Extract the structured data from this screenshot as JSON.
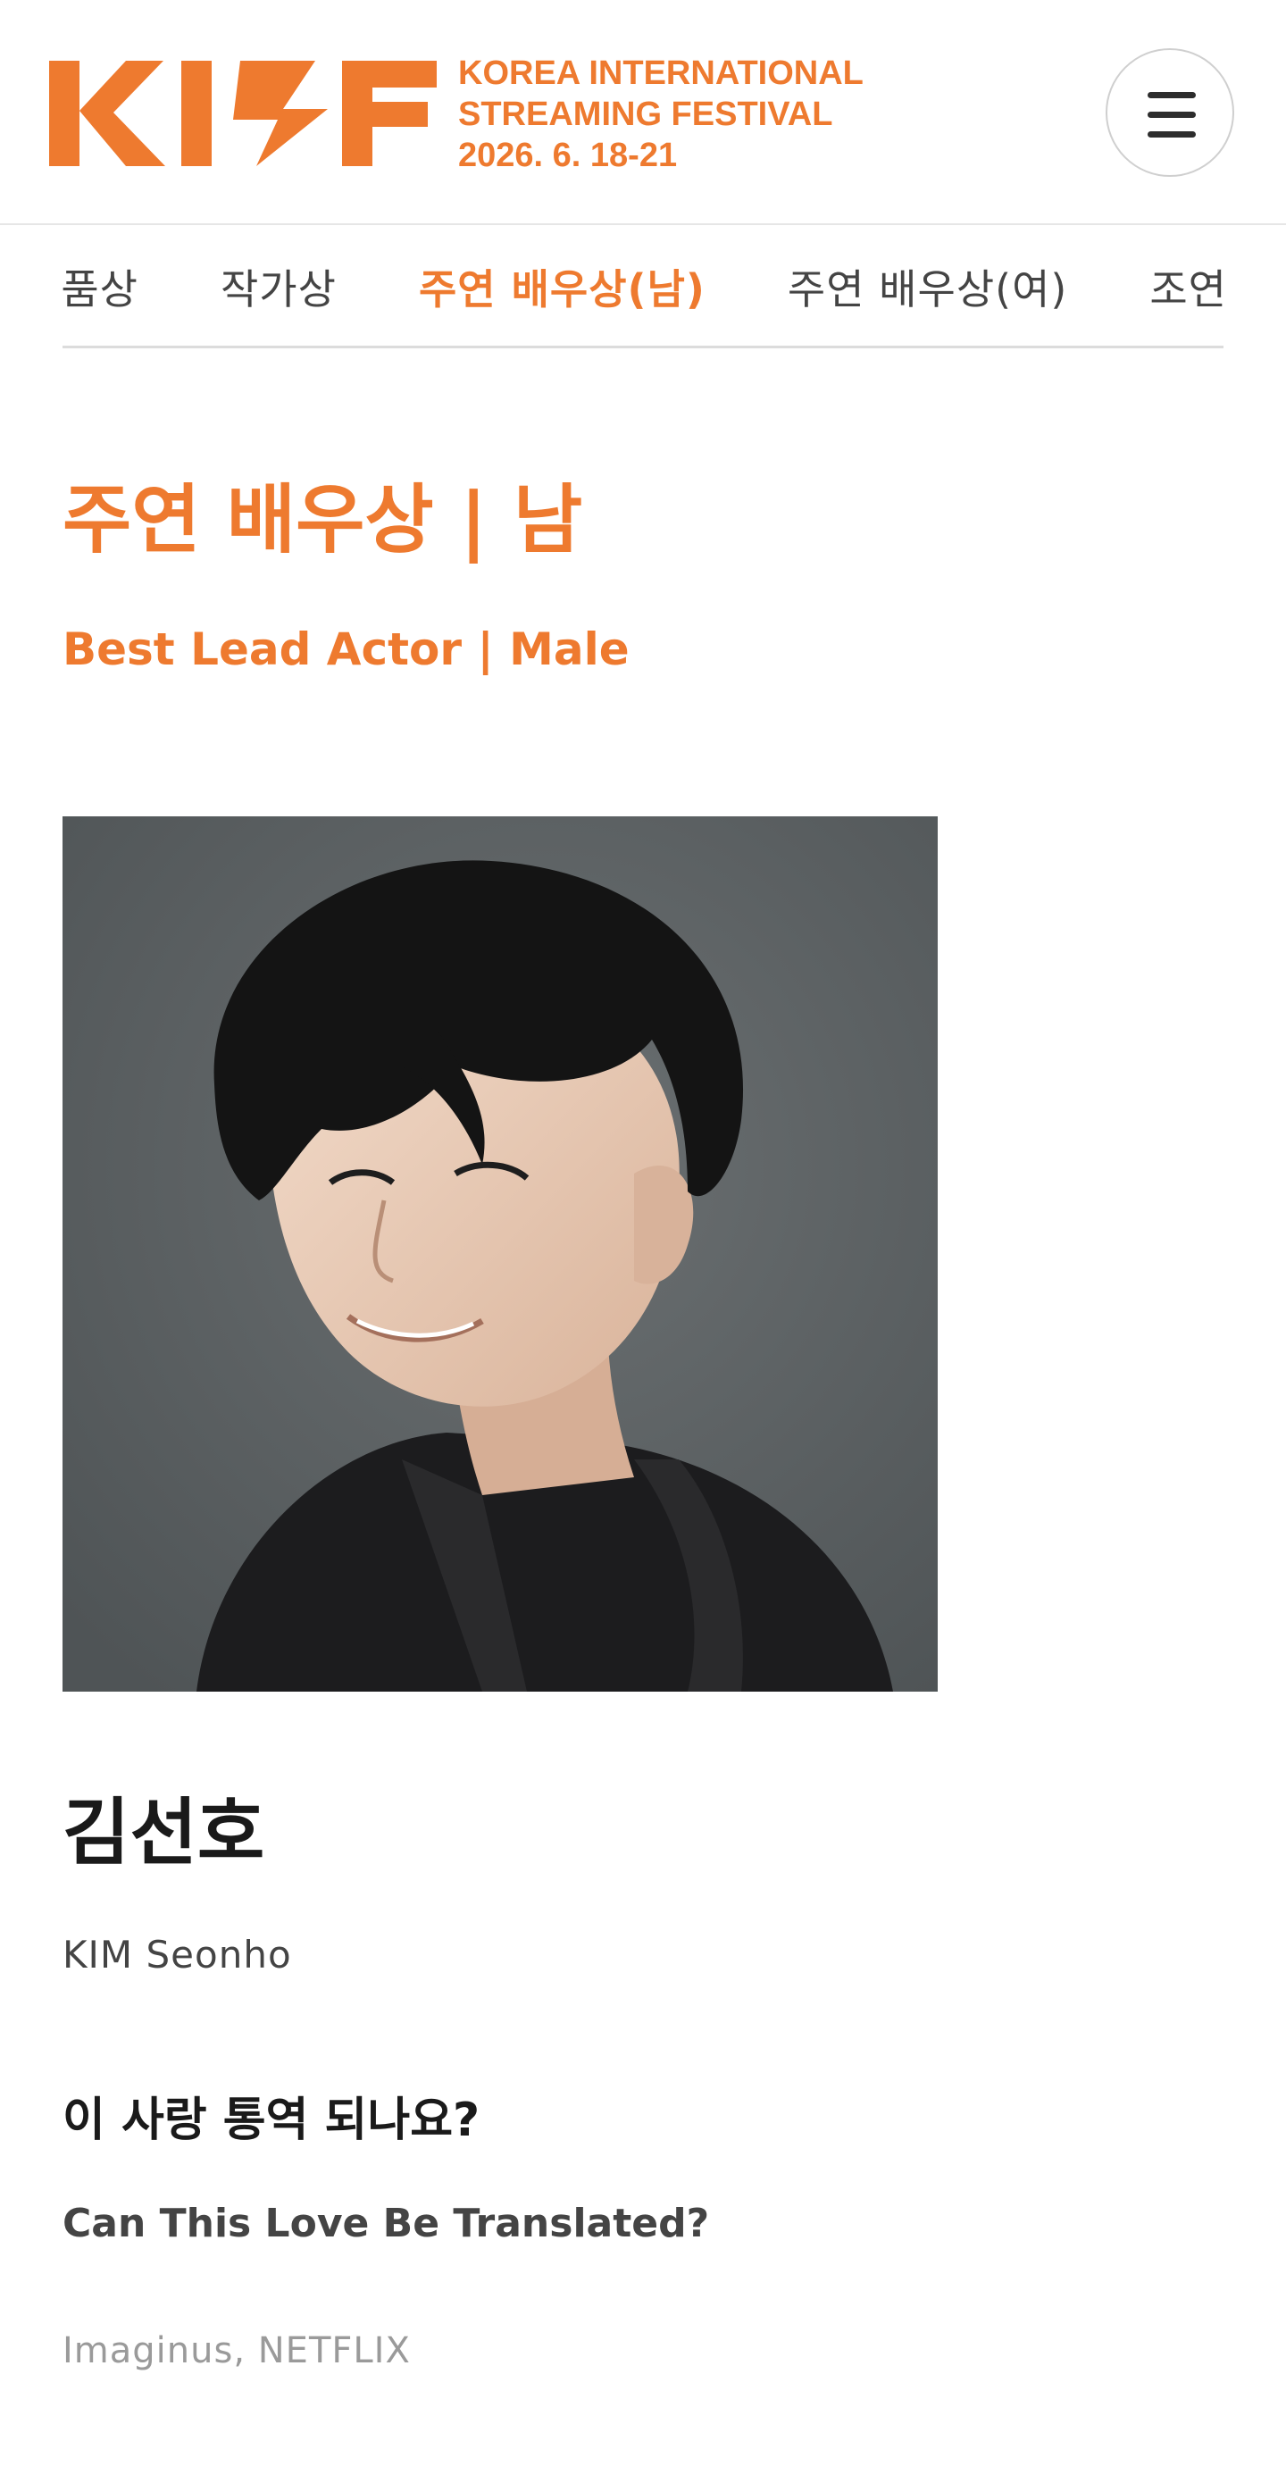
{
  "header": {
    "logo": {
      "wordmark": "KISF",
      "line1": "KOREA INTERNATIONAL",
      "line2": "STREAMING FESTIVAL",
      "dates": "2026. 6. 18-21"
    },
    "menu_icon": "hamburger-menu-icon"
  },
  "tabs": [
    {
      "label": "작품상",
      "active": false
    },
    {
      "label": "작가상",
      "active": false
    },
    {
      "label": "주연 배우상(남)",
      "active": true
    },
    {
      "label": "주연 배우상(여)",
      "active": false
    },
    {
      "label": "조연 배우상",
      "active": false
    }
  ],
  "category": {
    "title_ko": "주연 배우상 | 남",
    "title_en": "Best Lead Actor | Male"
  },
  "winner": {
    "name_ko": "김선호",
    "name_en": "KIM Seonho",
    "work_ko": "이 사랑 통역 되나요?",
    "work_en": "Can This Love Be Translated?",
    "studio": "Imaginus, NETFLIX"
  },
  "colors": {
    "accent": "#ee7a2f",
    "text": "#1a1a1a",
    "muted": "#9a9a9a",
    "divider": "#dcdcdc",
    "photo_background": "#5c6163"
  }
}
